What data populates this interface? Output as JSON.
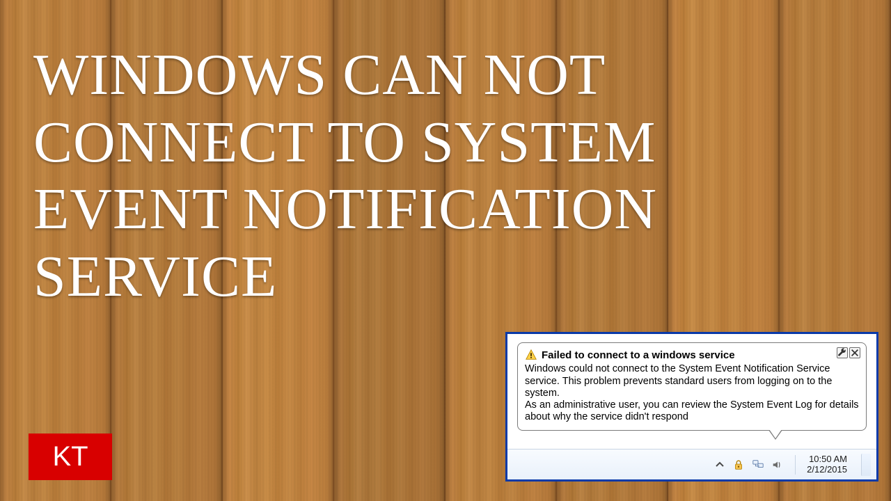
{
  "headline": "WINDOWS CAN NOT CONNECT TO SYSTEM EVENT NOTIFICATION SERVICE",
  "brand": "KT",
  "balloon": {
    "title": "Failed to connect to a windows service",
    "body": "Windows could not connect to the System Event Notification Service service. This problem prevents standard users from logging on to the system.\nAs an administrative user, you can review the System Event Log for details about why the service didn't respond"
  },
  "clock": {
    "time": "10:50 AM",
    "date": "2/12/2015"
  },
  "tray_icons": [
    "chevron-up-icon",
    "lock-icon",
    "network-icon",
    "volume-icon"
  ]
}
